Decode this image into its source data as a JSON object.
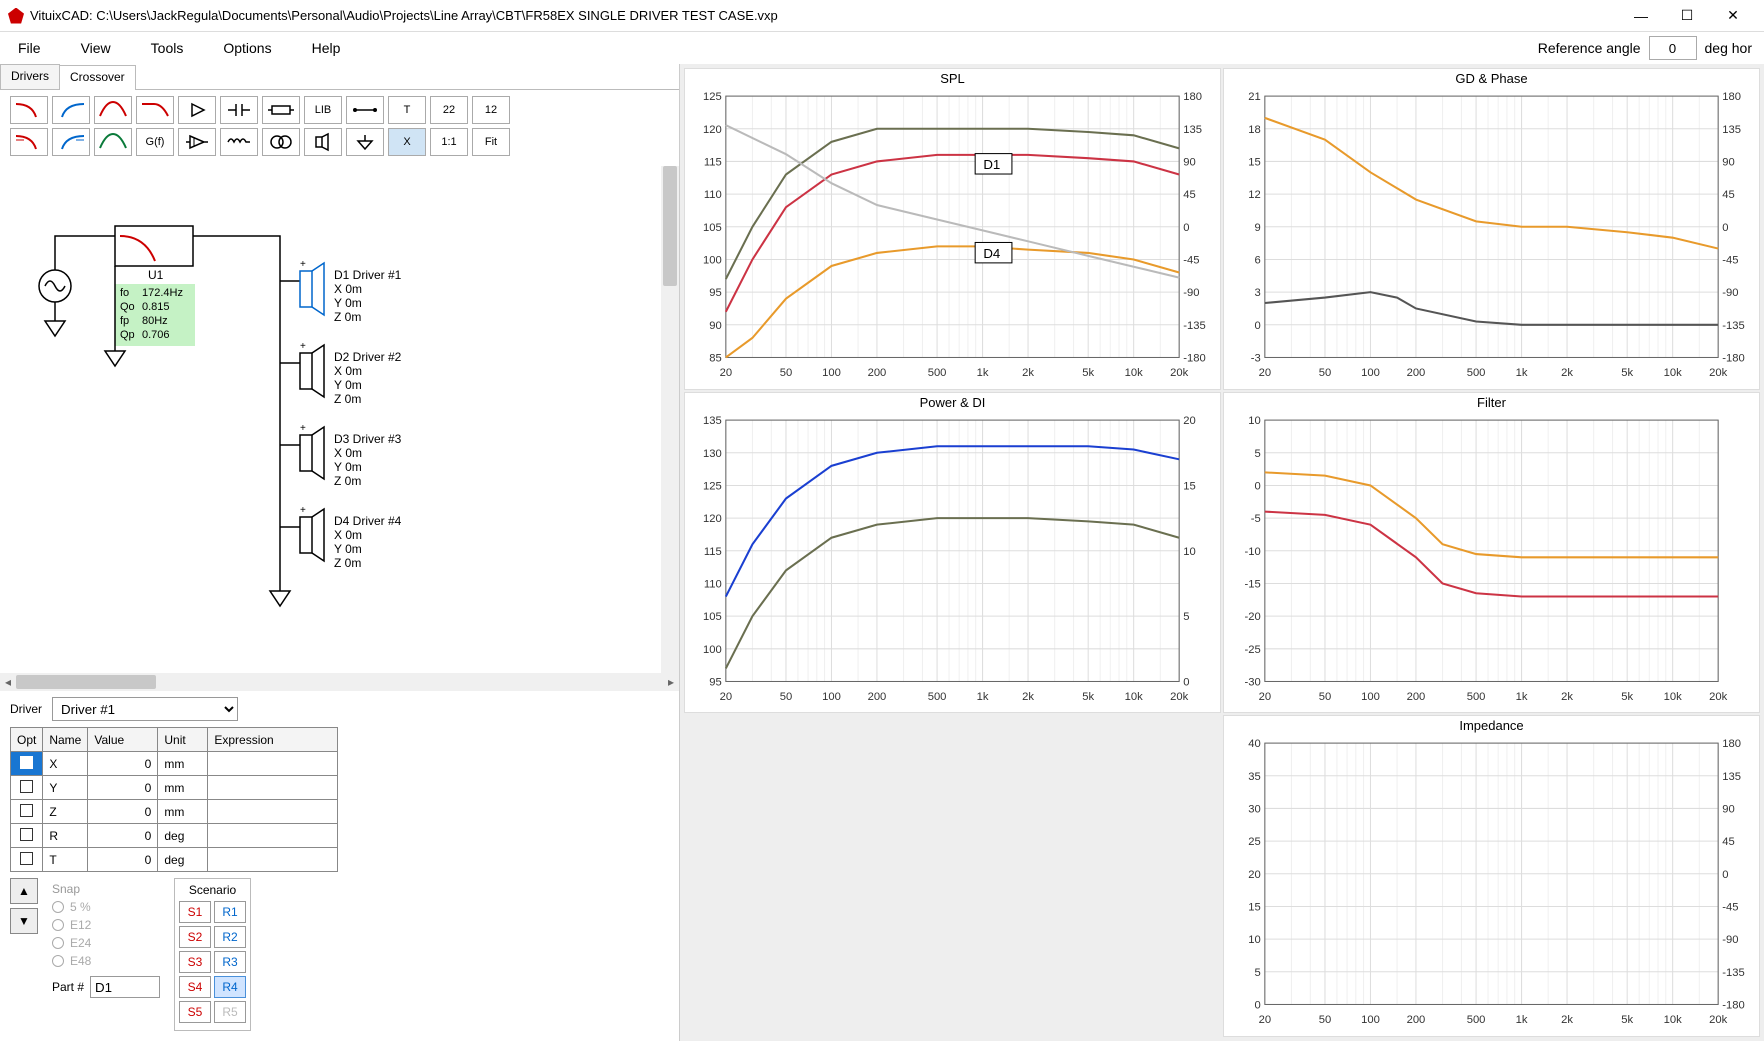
{
  "window": {
    "title": "VituixCAD: C:\\Users\\JackRegula\\Documents\\Personal\\Audio\\Projects\\Line Array\\CBT\\FR58EX SINGLE DRIVER TEST CASE.vxp"
  },
  "menu": {
    "file": "File",
    "view": "View",
    "tools": "Tools",
    "options": "Options",
    "help": "Help"
  },
  "refangle": {
    "label": "Reference angle",
    "value": "0",
    "unit": "deg hor"
  },
  "tabs": {
    "drivers": "Drivers",
    "crossover": "Crossover"
  },
  "toolbar": {
    "lib": "LIB",
    "t": "T",
    "n1": "22",
    "n2": "12",
    "gf": "G(f)",
    "x": "X",
    "ratio": "1:1",
    "fit": "Fit"
  },
  "schematic": {
    "u1": {
      "name": "U1",
      "fo_lbl": "fo",
      "fo": "172.4Hz",
      "qo_lbl": "Qo",
      "qo": "0.815",
      "fp_lbl": "fp",
      "fp": "80Hz",
      "qp_lbl": "Qp",
      "qp": "0.706"
    },
    "drivers": [
      {
        "id": "D1",
        "label": "D1 Driver #1",
        "x": "X 0m",
        "y": "Y 0m",
        "z": "Z 0m"
      },
      {
        "id": "D2",
        "label": "D2 Driver #2",
        "x": "X 0m",
        "y": "Y 0m",
        "z": "Z 0m"
      },
      {
        "id": "D3",
        "label": "D3 Driver #3",
        "x": "X 0m",
        "y": "Y 0m",
        "z": "Z 0m"
      },
      {
        "id": "D4",
        "label": "D4 Driver #4",
        "x": "X 0m",
        "y": "Y 0m",
        "z": "Z 0m"
      }
    ]
  },
  "driver_select": {
    "label": "Driver",
    "value": "Driver #1"
  },
  "prop_headers": {
    "opt": "Opt",
    "name": "Name",
    "value": "Value",
    "unit": "Unit",
    "expr": "Expression"
  },
  "props": [
    {
      "name": "X",
      "value": "0",
      "unit": "mm",
      "expr": ""
    },
    {
      "name": "Y",
      "value": "0",
      "unit": "mm",
      "expr": ""
    },
    {
      "name": "Z",
      "value": "0",
      "unit": "mm",
      "expr": ""
    },
    {
      "name": "R",
      "value": "0",
      "unit": "deg",
      "expr": ""
    },
    {
      "name": "T",
      "value": "0",
      "unit": "deg",
      "expr": ""
    }
  ],
  "snap": {
    "title": "Snap",
    "o5": "5 %",
    "o12": "E12",
    "o24": "E24",
    "o48": "E48"
  },
  "part": {
    "label": "Part #",
    "value": "D1"
  },
  "scenario": {
    "title": "Scenario",
    "rows": [
      {
        "s": "S1",
        "r": "R1"
      },
      {
        "s": "S2",
        "r": "R2"
      },
      {
        "s": "S3",
        "r": "R3"
      },
      {
        "s": "S4",
        "r": "R4"
      },
      {
        "s": "S5",
        "r": "R5"
      }
    ]
  },
  "chart_data": [
    {
      "id": "spl",
      "title": "SPL",
      "type": "line",
      "x_ticks": [
        "20",
        "50",
        "100",
        "200",
        "500",
        "1k",
        "2k",
        "5k",
        "10k",
        "20k"
      ],
      "y_left": {
        "min": 85,
        "max": 125,
        "step": 5
      },
      "y_right": {
        "min": -180,
        "max": 180,
        "step": 45
      },
      "annotations": [
        {
          "text": "D1",
          "x": 820,
          "y": 120
        },
        {
          "text": "D4",
          "x": 820,
          "y": 200
        }
      ],
      "series": [
        {
          "name": "D1",
          "color": "#cc3344",
          "axis": "left",
          "points": [
            [
              20,
              92
            ],
            [
              30,
              100
            ],
            [
              50,
              108
            ],
            [
              100,
              113
            ],
            [
              200,
              115
            ],
            [
              500,
              116
            ],
            [
              1000,
              116
            ],
            [
              2000,
              116
            ],
            [
              5000,
              115.5
            ],
            [
              10000,
              115
            ],
            [
              20000,
              113
            ]
          ]
        },
        {
          "name": "D4",
          "color": "#e89a2b",
          "axis": "left",
          "points": [
            [
              20,
              85
            ],
            [
              30,
              88
            ],
            [
              50,
              94
            ],
            [
              100,
              99
            ],
            [
              200,
              101
            ],
            [
              500,
              102
            ],
            [
              1000,
              102
            ],
            [
              2000,
              101.5
            ],
            [
              5000,
              101
            ],
            [
              10000,
              100
            ],
            [
              20000,
              98
            ]
          ]
        },
        {
          "name": "sum",
          "color": "#6a6f50",
          "axis": "left",
          "points": [
            [
              20,
              97
            ],
            [
              30,
              105
            ],
            [
              50,
              113
            ],
            [
              100,
              118
            ],
            [
              200,
              120
            ],
            [
              500,
              120
            ],
            [
              1000,
              120
            ],
            [
              2000,
              120
            ],
            [
              5000,
              119.5
            ],
            [
              10000,
              119
            ],
            [
              20000,
              117
            ]
          ]
        },
        {
          "name": "phase",
          "color": "#bababa",
          "axis": "right",
          "points": [
            [
              20,
              140
            ],
            [
              50,
              100
            ],
            [
              100,
              60
            ],
            [
              200,
              30
            ],
            [
              500,
              10
            ],
            [
              1000,
              -5
            ],
            [
              2000,
              -20
            ],
            [
              5000,
              -40
            ],
            [
              10000,
              -55
            ],
            [
              20000,
              -70
            ]
          ]
        }
      ]
    },
    {
      "id": "gdphase",
      "title": "GD & Phase",
      "type": "line",
      "x_ticks": [
        "20",
        "50",
        "100",
        "200",
        "500",
        "1k",
        "2k",
        "5k",
        "10k",
        "20k"
      ],
      "y_left": {
        "min": -3,
        "max": 21,
        "step": 3
      },
      "y_right": {
        "min": -180,
        "max": 180,
        "step": 45
      },
      "series": [
        {
          "name": "gd",
          "color": "#e89a2b",
          "axis": "left",
          "points": [
            [
              20,
              19
            ],
            [
              50,
              17
            ],
            [
              100,
              14
            ],
            [
              200,
              11.5
            ],
            [
              500,
              9.5
            ],
            [
              1000,
              9
            ],
            [
              2000,
              9
            ],
            [
              5000,
              8.5
            ],
            [
              10000,
              8
            ],
            [
              20000,
              7
            ]
          ]
        },
        {
          "name": "phase",
          "color": "#555",
          "axis": "left",
          "points": [
            [
              20,
              2
            ],
            [
              50,
              2.5
            ],
            [
              100,
              3
            ],
            [
              150,
              2.5
            ],
            [
              200,
              1.5
            ],
            [
              500,
              0.3
            ],
            [
              1000,
              0
            ],
            [
              2000,
              0
            ],
            [
              5000,
              0
            ],
            [
              10000,
              0
            ],
            [
              20000,
              0
            ]
          ]
        }
      ]
    },
    {
      "id": "powerdi",
      "title": "Power & DI",
      "type": "line",
      "x_ticks": [
        "20",
        "50",
        "100",
        "200",
        "500",
        "1k",
        "2k",
        "5k",
        "10k",
        "20k"
      ],
      "y_left": {
        "min": 95,
        "max": 135,
        "step": 5
      },
      "y_right": {
        "min": 0,
        "max": 20,
        "step": 5
      },
      "series": [
        {
          "name": "power",
          "color": "#1a3fd1",
          "axis": "left",
          "points": [
            [
              20,
              108
            ],
            [
              30,
              116
            ],
            [
              50,
              123
            ],
            [
              100,
              128
            ],
            [
              200,
              130
            ],
            [
              500,
              131
            ],
            [
              1000,
              131
            ],
            [
              2000,
              131
            ],
            [
              5000,
              131
            ],
            [
              10000,
              130.5
            ],
            [
              20000,
              129
            ]
          ]
        },
        {
          "name": "di",
          "color": "#6a6f50",
          "axis": "left",
          "points": [
            [
              20,
              97
            ],
            [
              30,
              105
            ],
            [
              50,
              112
            ],
            [
              100,
              117
            ],
            [
              200,
              119
            ],
            [
              500,
              120
            ],
            [
              1000,
              120
            ],
            [
              2000,
              120
            ],
            [
              5000,
              119.5
            ],
            [
              10000,
              119
            ],
            [
              20000,
              117
            ]
          ]
        }
      ]
    },
    {
      "id": "filter",
      "title": "Filter",
      "type": "line",
      "x_ticks": [
        "20",
        "50",
        "100",
        "200",
        "500",
        "1k",
        "2k",
        "5k",
        "10k",
        "20k"
      ],
      "y_left": {
        "min": -30,
        "max": 10,
        "step": 5
      },
      "series": [
        {
          "name": "f1",
          "color": "#e89a2b",
          "axis": "left",
          "points": [
            [
              20,
              2
            ],
            [
              50,
              1.5
            ],
            [
              100,
              0
            ],
            [
              200,
              -5
            ],
            [
              300,
              -9
            ],
            [
              500,
              -10.5
            ],
            [
              1000,
              -11
            ],
            [
              2000,
              -11
            ],
            [
              5000,
              -11
            ],
            [
              10000,
              -11
            ],
            [
              20000,
              -11
            ]
          ]
        },
        {
          "name": "f2",
          "color": "#cc3344",
          "axis": "left",
          "points": [
            [
              20,
              -4
            ],
            [
              50,
              -4.5
            ],
            [
              100,
              -6
            ],
            [
              200,
              -11
            ],
            [
              300,
              -15
            ],
            [
              500,
              -16.5
            ],
            [
              1000,
              -17
            ],
            [
              2000,
              -17
            ],
            [
              5000,
              -17
            ],
            [
              10000,
              -17
            ],
            [
              20000,
              -17
            ]
          ]
        }
      ]
    },
    {
      "id": "impedance",
      "title": "Impedance",
      "type": "line",
      "x_ticks": [
        "20",
        "50",
        "100",
        "200",
        "500",
        "1k",
        "2k",
        "5k",
        "10k",
        "20k"
      ],
      "y_left": {
        "min": 0,
        "max": 40,
        "step": 5
      },
      "y_right": {
        "min": -180,
        "max": 180,
        "step": 45
      },
      "series": []
    }
  ]
}
